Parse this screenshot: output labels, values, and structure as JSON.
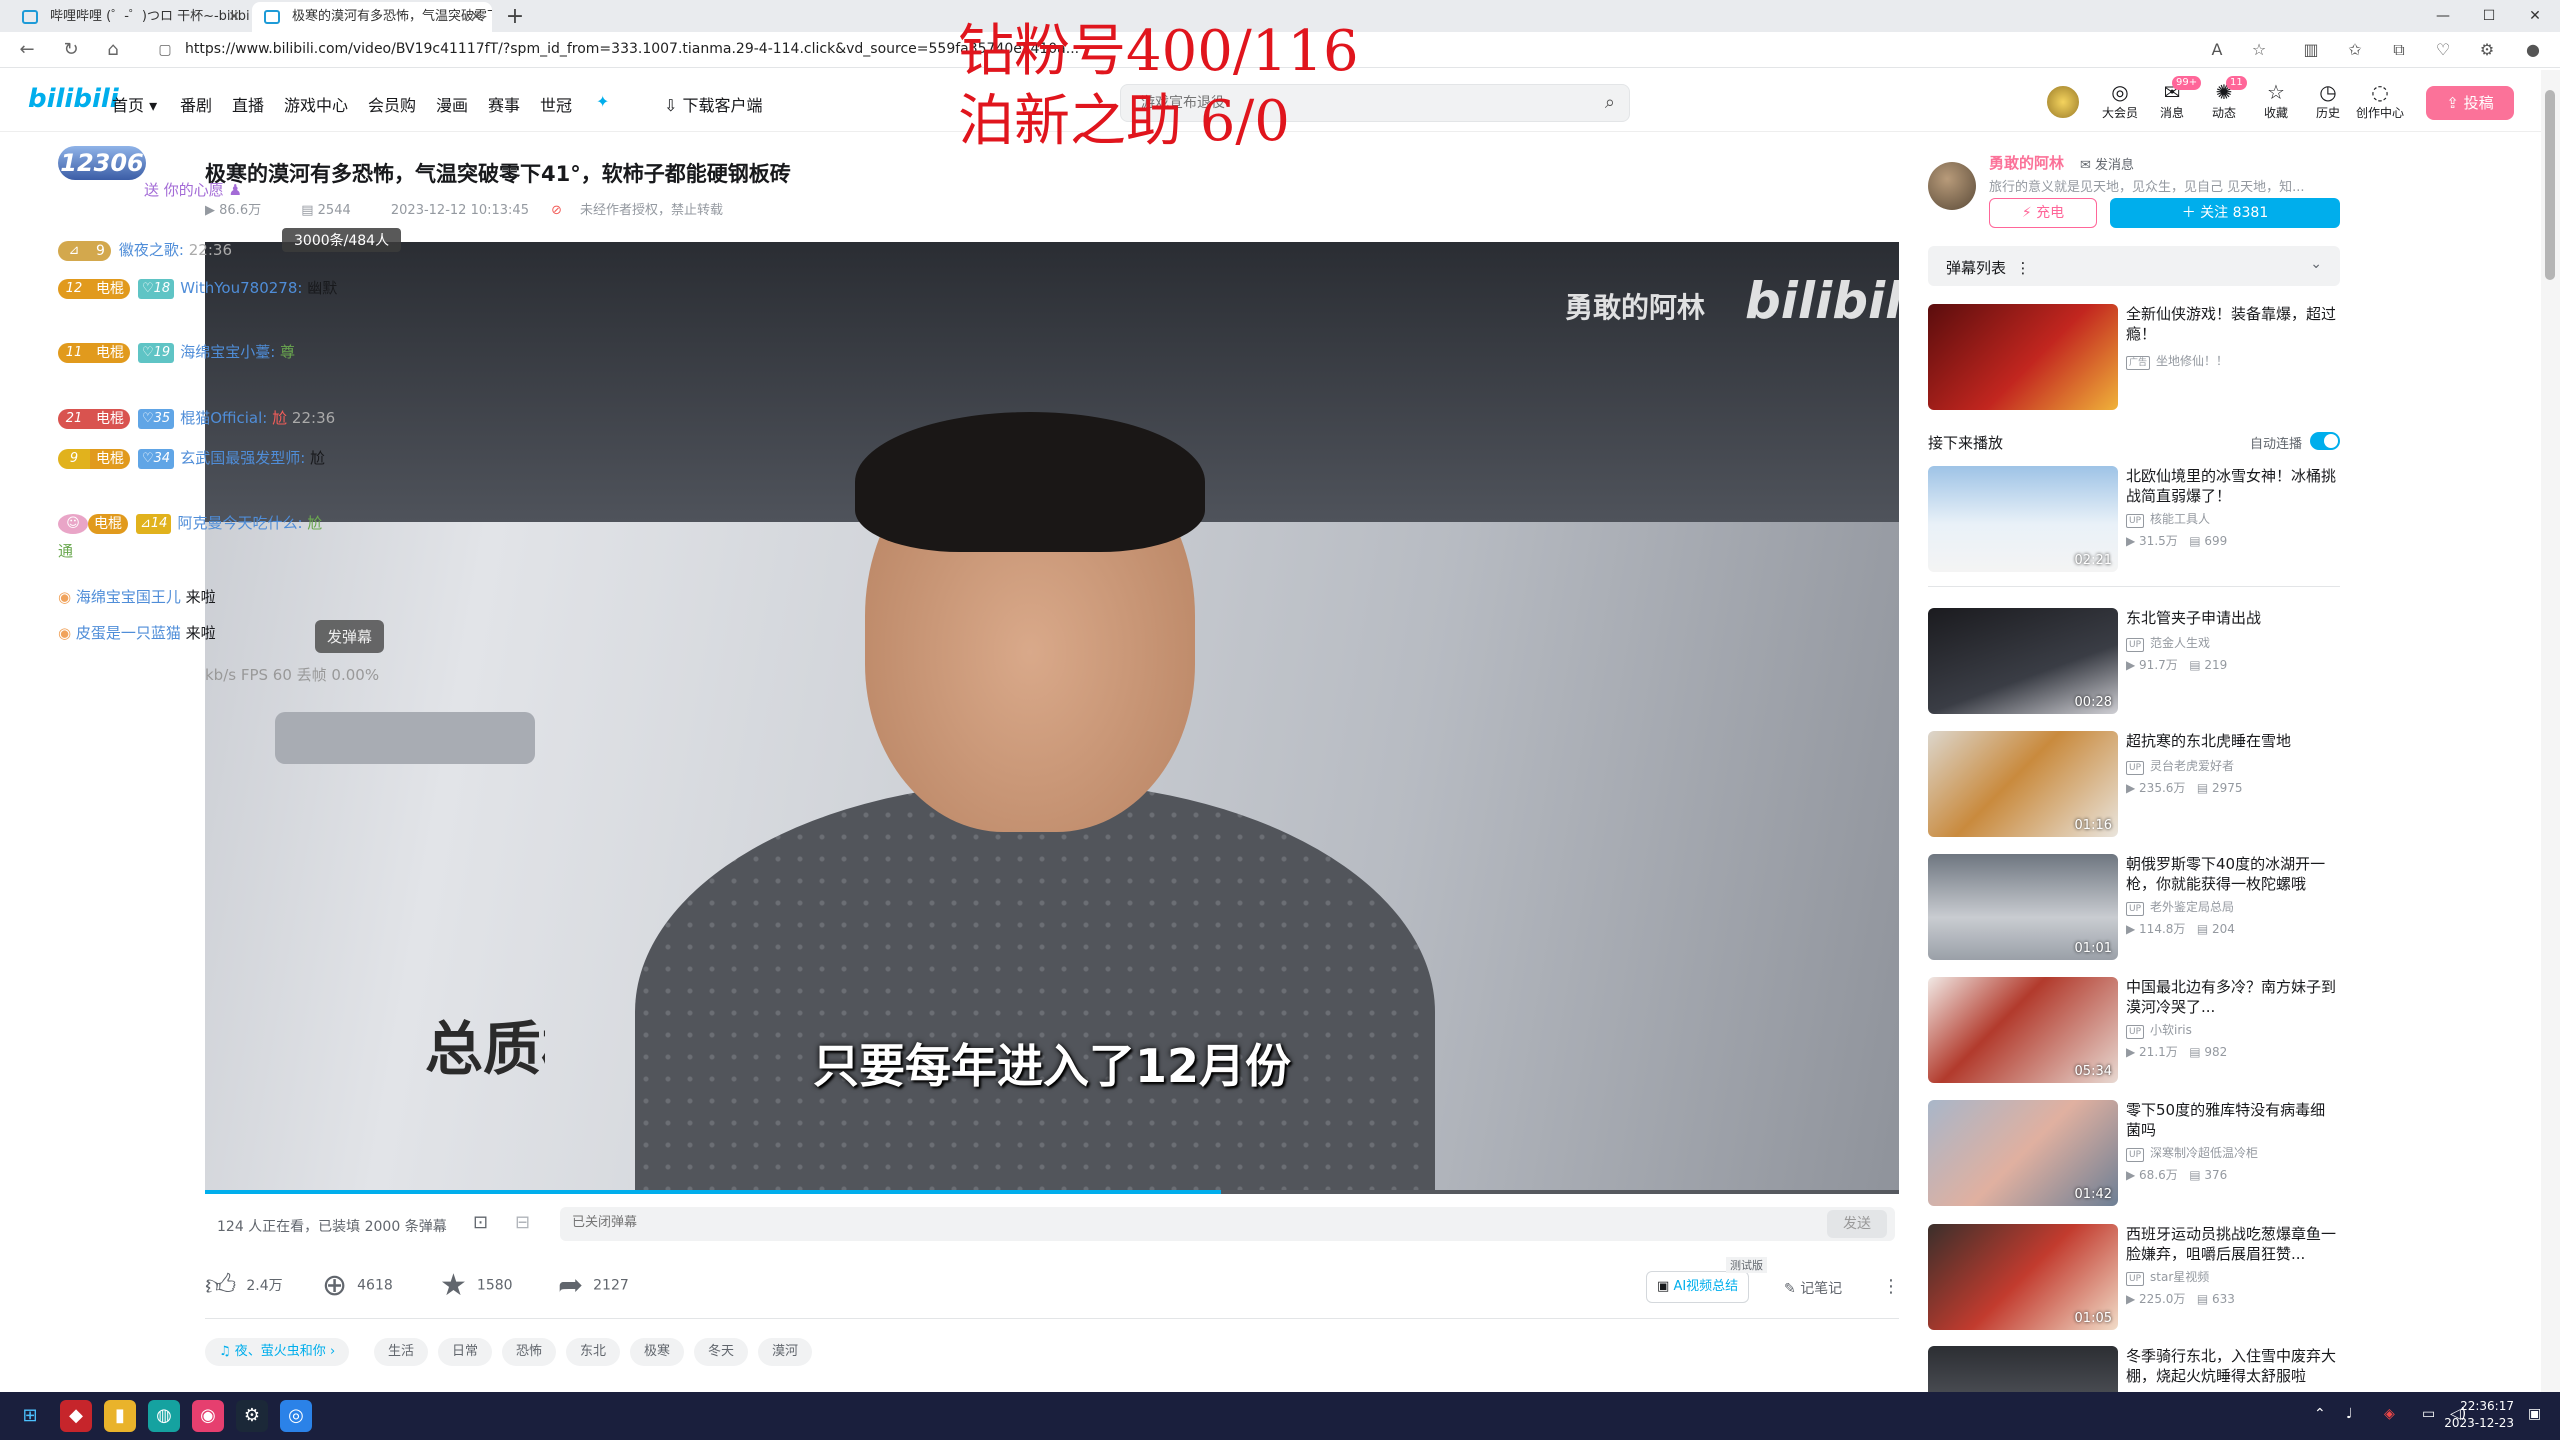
{
  "browser": {
    "tabs": [
      {
        "label": "哔哩哔哩 (゜-゜)つロ 干杯~-bilibili"
      },
      {
        "label": "极寒的漠河有多恐怖，气温突破零下41°，软柿子都能硬钢板砖"
      }
    ],
    "url": "https://www.bilibili.com/video/BV19c41117fT/?spm_id_from=333.1007.tianma.29-4-114.click&vd_source=559fa35740ea410a..."
  },
  "overlay": {
    "line1": "钻粉号400/116",
    "line2": "泊新之助   6/0"
  },
  "site": {
    "logo": "bilibili",
    "nav": [
      "首页",
      "番剧",
      "直播",
      "游戏中心",
      "会员购",
      "漫画",
      "赛事",
      "世冠"
    ],
    "download": "下载客户端",
    "search_placeholder": "游戏宣布退役",
    "header_icons": [
      {
        "label": "大会员",
        "icon": "vip-icon"
      },
      {
        "label": "消息",
        "icon": "message-icon",
        "badge": "99+"
      },
      {
        "label": "动态",
        "icon": "dynamic-icon",
        "badge": "11"
      },
      {
        "label": "收藏",
        "icon": "star-icon"
      },
      {
        "label": "历史",
        "icon": "clock-icon"
      },
      {
        "label": "创作中心",
        "icon": "bulb-icon"
      }
    ],
    "post_button": "投稿"
  },
  "danmaku_overlay": {
    "count_badge": "12306",
    "gift_line": "送 你的心愿",
    "items": [
      {
        "level": "9",
        "medal": "",
        "fan_level": "",
        "user": "徽夜之歌:",
        "message": "",
        "time": "22:36"
      },
      {
        "level": "12",
        "medal": "电棍",
        "fan_level": "18",
        "user": "WithYou780278:",
        "message": "幽默",
        "time": ""
      },
      {
        "level": "11",
        "medal": "电棍",
        "fan_level": "19",
        "user": "海绵宝宝小薹:",
        "message": "尊",
        "time": ""
      },
      {
        "level": "21",
        "medal": "电棍",
        "fan_level": "35",
        "user": "棍猫Official:",
        "message": "尬",
        "time": "22:36"
      },
      {
        "level": "9",
        "medal": "电棍",
        "fan_level": "34",
        "user": "玄武国最强发型师:",
        "message": "尬",
        "time": ""
      },
      {
        "level": "",
        "medal": "电棍",
        "fan_level": "14",
        "user": "阿克曼今天吃什么:",
        "message": "尬",
        "time": ""
      }
    ],
    "extra_text": "通",
    "entries": [
      {
        "user": "海绵宝宝国王儿",
        "action": "来啦"
      },
      {
        "user": "皮蛋是一只蓝猫",
        "action": "来啦"
      }
    ],
    "send_hint": "发弹幕",
    "stats": "kb/s  FPS 60  丢帧 0.00%",
    "tooltip": "3000条/484人"
  },
  "video": {
    "title": "极寒的漠河有多恐怖，气温突破零下41°，软柿子都能硬钢板砖",
    "views": "86.6万",
    "danmaku_count": "2544",
    "date": "2023-12-12 10:13:45",
    "copyright": "未经作者授权，禁止转载",
    "watermark_name": "勇敢的阿林",
    "watermark_logo": "bilibili",
    "sign_text": "总质栏板",
    "subtitle": "只要每年进入了12月份",
    "progress": 0.6
  },
  "danmaku_bar": {
    "watchers": "124 人正在看，已装填 2000 条弹幕",
    "input_placeholder": "已关闭弹幕",
    "send": "发送"
  },
  "toolbar": {
    "like": "2.4万",
    "coin": "4618",
    "favorite": "1580",
    "share": "2127",
    "ai_summary": "AI视频总结",
    "beta": "测试版",
    "notes": "记笔记"
  },
  "tags": [
    "夜、萤火虫和你",
    "生活",
    "日常",
    "恐怖",
    "东北",
    "极寒",
    "冬天",
    "漠河"
  ],
  "uploader": {
    "name": "勇敢的阿林",
    "message": "发消息",
    "desc": "旅行的意义就是见天地，见众生，见自己 见天地，知...",
    "charge": "充电",
    "follow": "关注 8381"
  },
  "danmaku_list": {
    "label": "弹幕列表"
  },
  "ad_card": {
    "title": "全新仙侠游戏！装备靠爆，超过瘾！",
    "author": "坐地修仙！！",
    "tag": "广告"
  },
  "next_label": "接下来播放",
  "autoplay_label": "自动连播",
  "recommendations": [
    {
      "title": "北欧仙境里的冰雪女神！冰桶挑战简直弱爆了！",
      "author": "核能工具人",
      "views": "31.5万",
      "danmaku": "699",
      "duration": "02:21"
    },
    {
      "title": "东北管夹子申请出战",
      "author": "范金人生戏",
      "views": "91.7万",
      "danmaku": "219",
      "duration": "00:28"
    },
    {
      "title": "超抗寒的东北虎睡在雪地",
      "author": "灵台老虎爱好者",
      "views": "235.6万",
      "danmaku": "2975",
      "duration": "01:16"
    },
    {
      "title": "朝俄罗斯零下40度的冰湖开一枪，你就能获得一枚陀螺哦",
      "author": "老外鉴定局总局",
      "views": "114.8万",
      "danmaku": "204",
      "duration": "01:01"
    },
    {
      "title": "中国最北边有多冷？南方妹子到漠河冷哭了...",
      "author": "小软iris",
      "views": "21.1万",
      "danmaku": "982",
      "duration": "05:34"
    },
    {
      "title": "零下50度的雅库特没有病毒细菌吗",
      "author": "深寒制冷超低温冷柜",
      "views": "68.6万",
      "danmaku": "376",
      "duration": "01:42"
    },
    {
      "title": "西班牙运动员挑战吃葱爆章鱼一脸嫌弃，咀嚼后展眉狂赞...",
      "author": "star星视频",
      "views": "225.0万",
      "danmaku": "633",
      "duration": "01:05"
    },
    {
      "title": "冬季骑行东北，入住雪中废弃大棚，烧起火炕睡得太舒服啦",
      "author": "",
      "views": "",
      "danmaku": "",
      "duration": ""
    }
  ],
  "taskbar": {
    "time": "22:36:17",
    "date": "2023-12-23"
  }
}
